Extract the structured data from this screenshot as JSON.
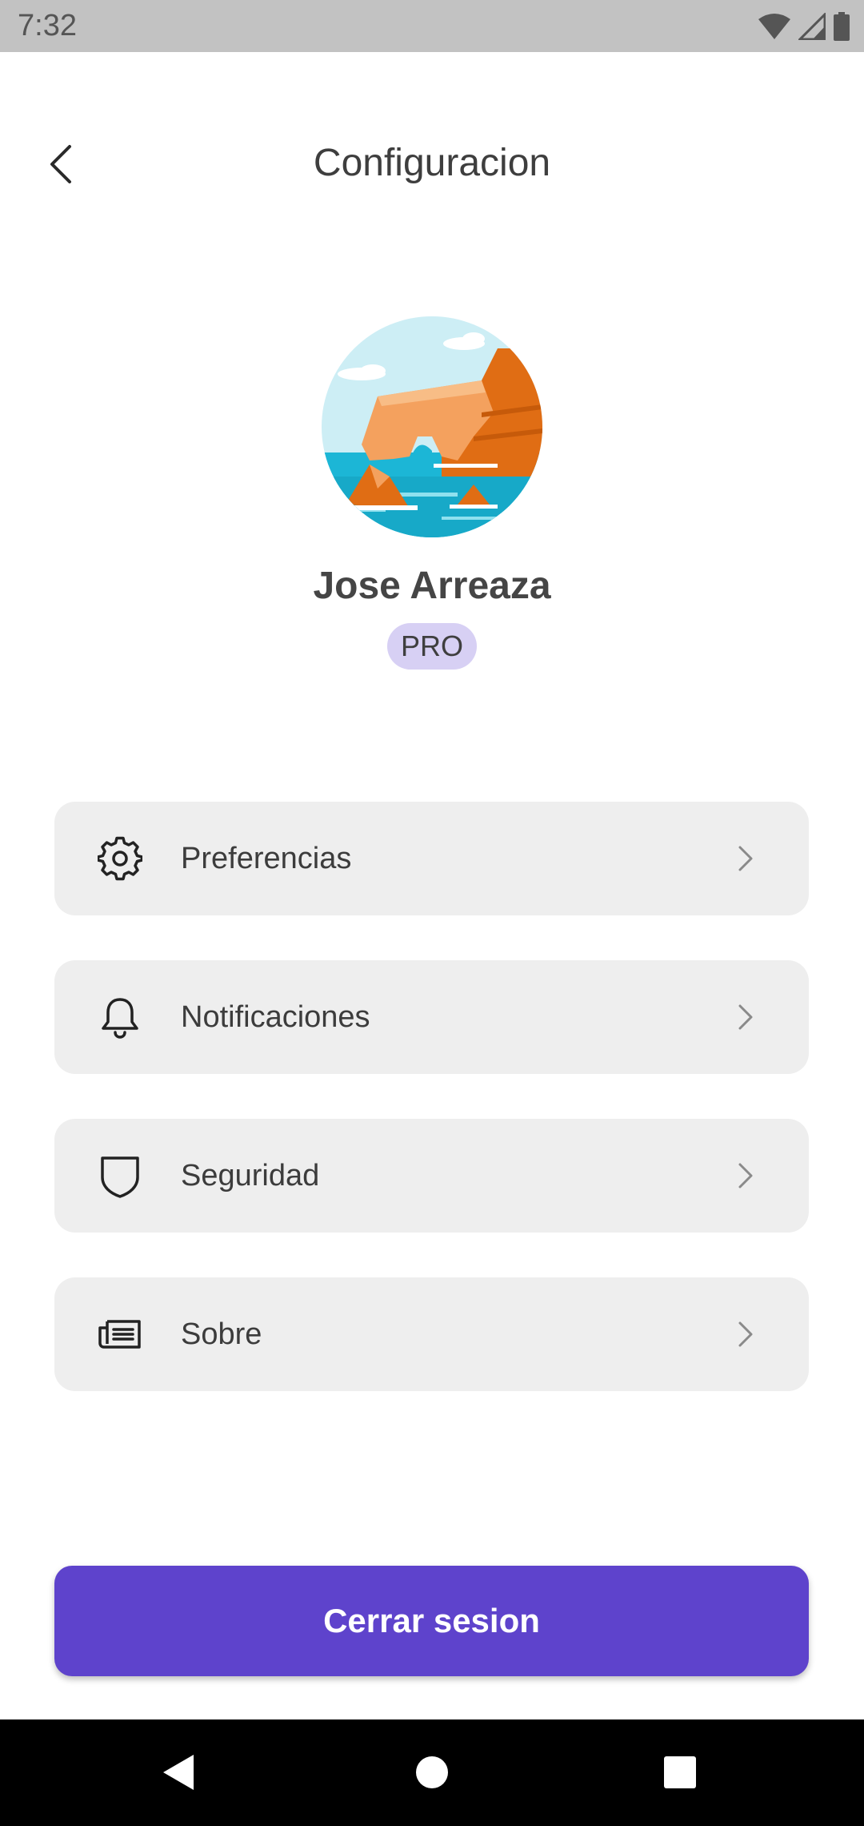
{
  "status_bar": {
    "time": "7:32",
    "icons": [
      "wifi-icon",
      "signal-icon",
      "battery-icon"
    ]
  },
  "header": {
    "title": "Configuracion",
    "back_icon": "chevron-left-icon"
  },
  "profile": {
    "name": "Jose Arreaza",
    "badge": "PRO",
    "avatar": "coastal-cliffs-illustration"
  },
  "menu": {
    "items": [
      {
        "label": "Preferencias",
        "icon": "gear-icon"
      },
      {
        "label": "Notificaciones",
        "icon": "bell-icon"
      },
      {
        "label": "Seguridad",
        "icon": "shield-icon"
      },
      {
        "label": "Sobre",
        "icon": "newspaper-icon"
      }
    ]
  },
  "logout": {
    "label": "Cerrar sesion"
  },
  "nav_bar": {
    "buttons": [
      "back-nav-icon",
      "home-nav-icon",
      "recents-nav-icon"
    ]
  },
  "colors": {
    "accent": "#5e43cc",
    "badge_bg": "#d7d0f4",
    "menu_bg": "#eeeeee",
    "status_bar": "#c2c2c2"
  }
}
